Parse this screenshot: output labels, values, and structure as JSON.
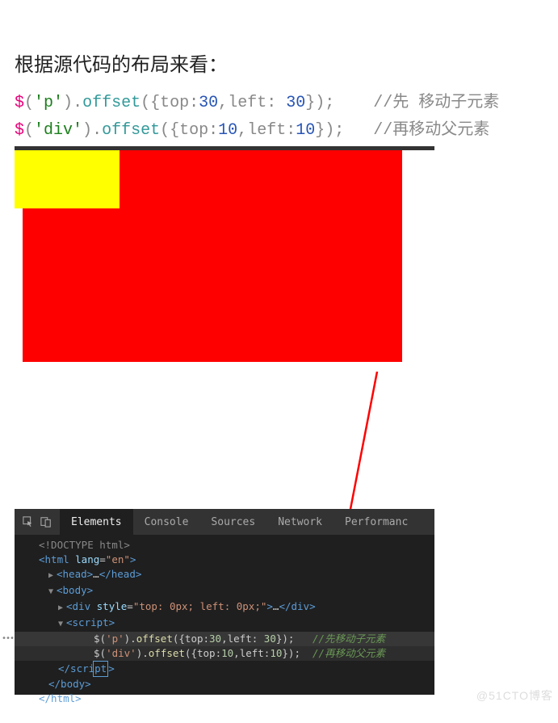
{
  "heading": "根据源代码的布局来看：",
  "code": {
    "line1": {
      "dollar": "$",
      "po": "(",
      "s": "'p'",
      "pc": ")",
      "dot": ".",
      "fn": "offset",
      "po2": "(",
      "bo": "{",
      "k1": "top",
      "c1": ":",
      "n1": "30",
      "cm": ",",
      "k2": "left",
      "c2": ": ",
      "n2": "30",
      "bc": "}",
      "pc2": ")",
      "sc": ";",
      "cmt": "//先 移动子元素"
    },
    "line2": {
      "dollar": "$",
      "po": "(",
      "s": "'div'",
      "pc": ")",
      "dot": ".",
      "fn": "offset",
      "po2": "(",
      "bo": "{",
      "k1": "top",
      "c1": ":",
      "n1": "10",
      "cm": ",",
      "k2": "left",
      "c2": ":",
      "n2": "10",
      "bc": "}",
      "pc2": ")",
      "sc": ";",
      "cmt": "//再移动父元素"
    }
  },
  "devtools": {
    "tabs": {
      "elements": "Elements",
      "console": "Console",
      "sources": "Sources",
      "network": "Network",
      "performance": "Performanc"
    },
    "tree": {
      "doctype": "<!DOCTYPE html>",
      "html_open_a": "<html ",
      "html_lang_k": "lang",
      "html_eq": "=",
      "html_lang_v": "\"en\"",
      "html_open_b": ">",
      "head_open": "<head>",
      "head_dots": "…",
      "head_close": "</head>",
      "body_open": "<body>",
      "div_open_a": "<div ",
      "div_style_k": "style",
      "div_eq": "=",
      "div_style_v": "\"top: 0px; left: 0px;\"",
      "div_open_b": ">",
      "div_dots": "…",
      "div_close": "</div>",
      "script_open": "<script>",
      "js1": {
        "pre": "$(",
        "s": "'p'",
        "mid": ").",
        "fn": "offset",
        "po": "({",
        "k1": "top",
        "c1": ":",
        "n1": "30",
        "cm": ",",
        "k2": "left",
        "c2": ": ",
        "n2": "30",
        "pc": "});",
        "cmt": "//先移动子元素"
      },
      "js2": {
        "pre": "$(",
        "s": "'div'",
        "mid": ").",
        "fn": "offset",
        "po": "({",
        "k1": "top",
        "c1": ":",
        "n1": "10",
        "cm": ",",
        "k2": "left",
        "c2": ":",
        "n2": "10",
        "pc": "});",
        "cmt": "//再移动父元素"
      },
      "script_close_a": "</scri",
      "script_close_b": "pt",
      "script_close_c": ">",
      "body_close": "</body>",
      "html_close": "</html>"
    }
  },
  "watermark": "@51CTO博客"
}
